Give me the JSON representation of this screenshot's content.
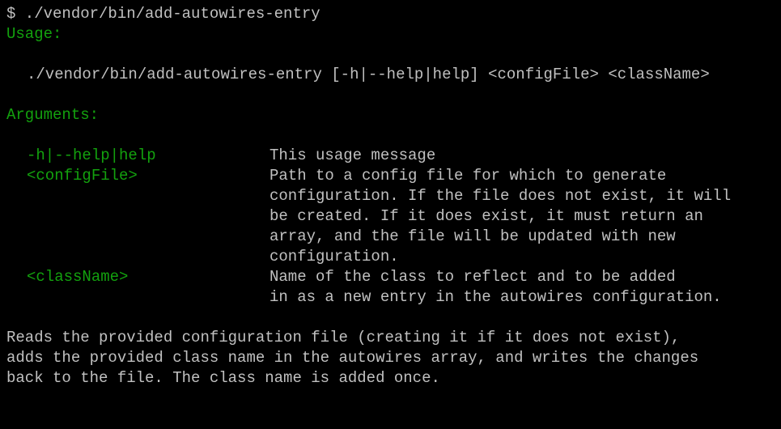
{
  "terminal": {
    "text_color": "#c0c0c0",
    "highlight_color": "#13a10e",
    "background_color": "#000000",
    "prompt": "$ ./vendor/bin/add-autowires-entry",
    "usage_heading": "Usage:",
    "usage_line": "./vendor/bin/add-autowires-entry [-h|--help|help] <configFile> <className>",
    "arguments_heading": "Arguments:",
    "arguments": [
      {
        "name": "-h|--help|help",
        "description": [
          "This usage message"
        ]
      },
      {
        "name": "<configFile>",
        "description": [
          "Path to a config file for which to generate",
          "configuration. If the file does not exist, it will",
          "be created. If it does exist, it must return an",
          "array, and the file will be updated with new",
          "configuration."
        ]
      },
      {
        "name": "<className>",
        "description": [
          "Name of the class to reflect and to be added",
          "in as a new entry in the autowires configuration."
        ]
      }
    ],
    "summary": [
      "Reads the provided configuration file (creating it if it does not exist),",
      "adds the provided class name in the autowires array, and writes the changes",
      "back to the file. The class name is added once."
    ]
  }
}
